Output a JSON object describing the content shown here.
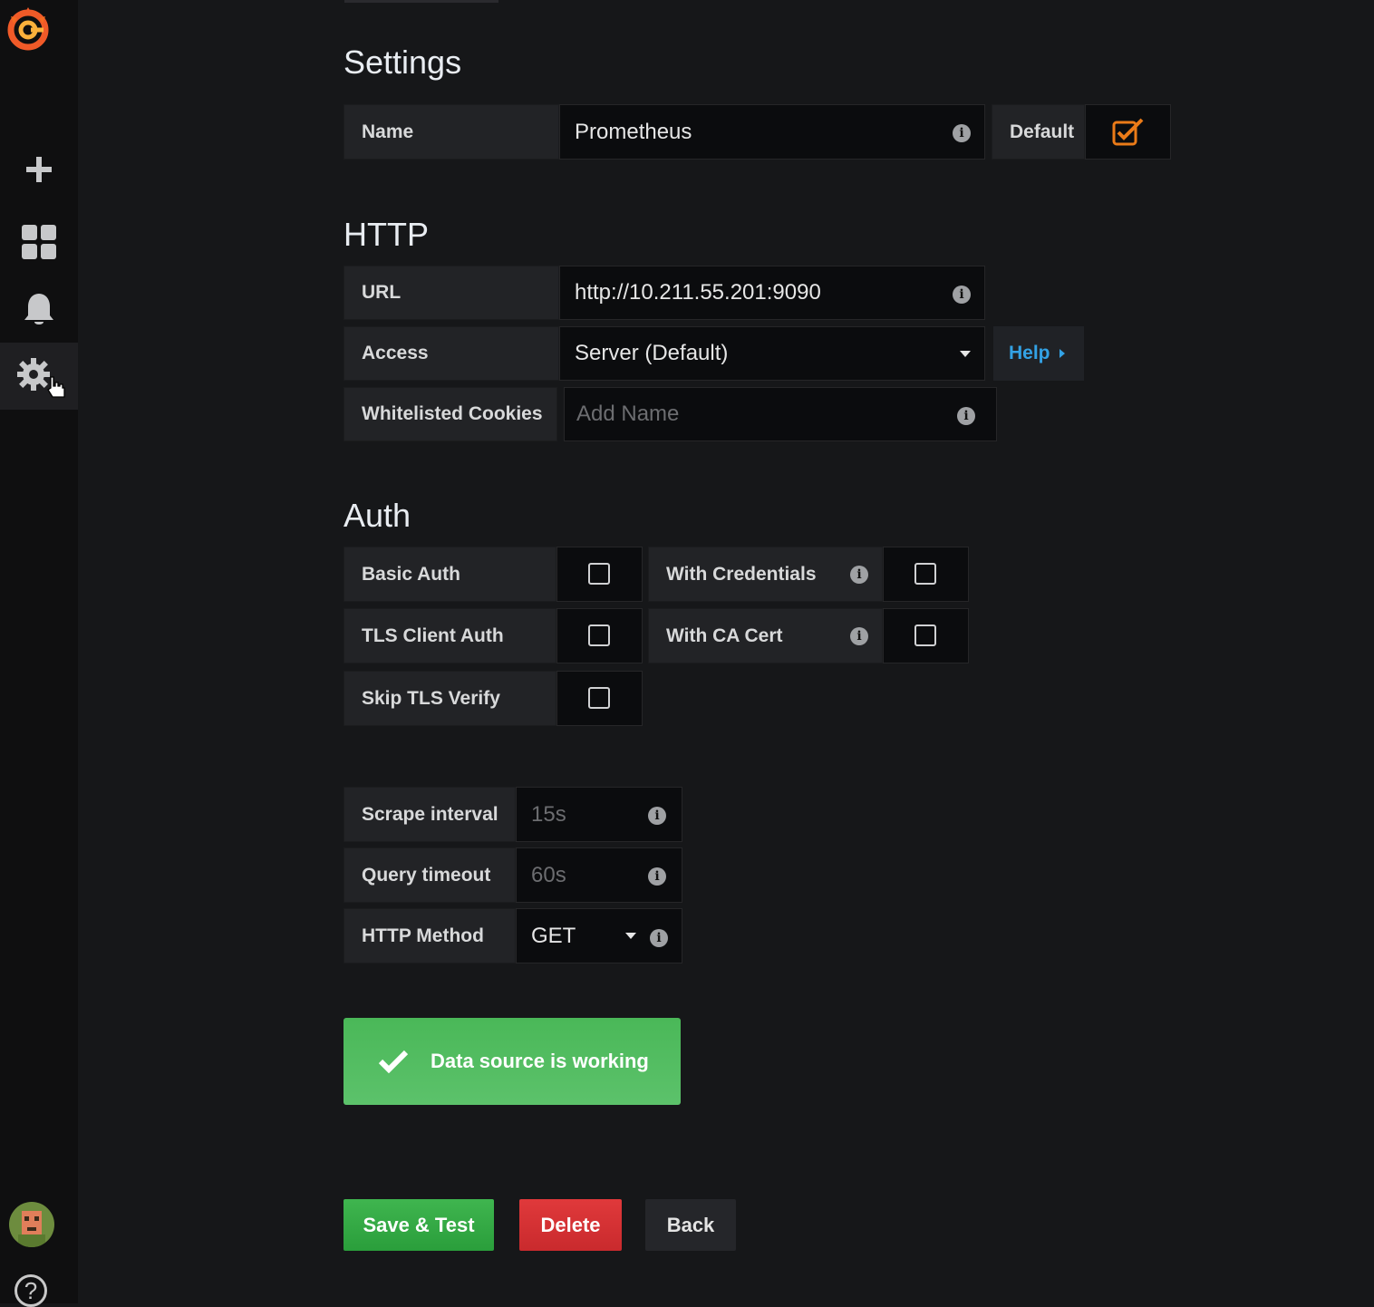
{
  "sidebar": {
    "items": [
      {
        "icon": "plus-icon",
        "label": ""
      },
      {
        "icon": "dashboards-icon",
        "label": ""
      },
      {
        "icon": "bell-icon",
        "label": ""
      },
      {
        "icon": "gear-icon",
        "label": "",
        "active": true
      }
    ],
    "help_glyph": "?"
  },
  "settings": {
    "title": "Settings",
    "name_label": "Name",
    "name_value": "Prometheus",
    "default_label": "Default",
    "default_checked": true
  },
  "http": {
    "title": "HTTP",
    "url_label": "URL",
    "url_value": "http://10.211.55.201:9090",
    "access_label": "Access",
    "access_value": "Server (Default)",
    "help_label": "Help",
    "cookies_label": "Whitelisted Cookies",
    "cookies_placeholder": "Add Name"
  },
  "auth": {
    "title": "Auth",
    "basic_auth": "Basic Auth",
    "tls_client_auth": "TLS Client Auth",
    "skip_tls_verify": "Skip TLS Verify",
    "with_credentials": "With Credentials",
    "with_ca_cert": "With CA Cert"
  },
  "prometheus": {
    "scrape_label": "Scrape interval",
    "scrape_placeholder": "15s",
    "timeout_label": "Query timeout",
    "timeout_placeholder": "60s",
    "method_label": "HTTP Method",
    "method_value": "GET"
  },
  "alert": {
    "message": "Data source is working"
  },
  "actions": {
    "save": "Save & Test",
    "delete": "Delete",
    "back": "Back"
  },
  "colors": {
    "accent_orange": "#eb7b18",
    "success_green": "#3fb54f",
    "danger_red": "#e0393b",
    "link_blue": "#33a2e5"
  }
}
